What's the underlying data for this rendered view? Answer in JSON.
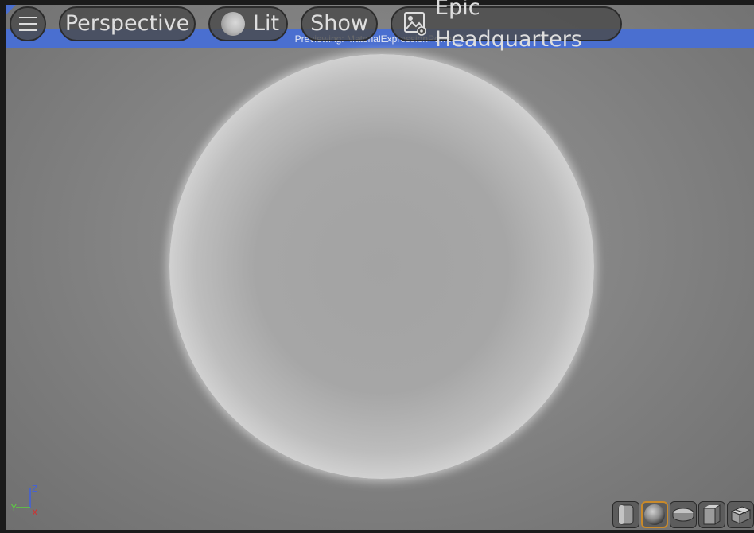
{
  "toolbar": {
    "menu_icon": "hamburger-menu-icon",
    "view_mode_label": "Perspective",
    "lighting_label": "Lit",
    "lighting_icon": "lit-sphere-icon",
    "show_label": "Show",
    "preview_scene_label": "Epic Headquarters",
    "preview_scene_icon": "scene-settings-icon"
  },
  "preview_banner": {
    "text": "Previewing: MaterialExpressionPower_3",
    "color": "#4a6fd0"
  },
  "axis_widget": {
    "x_label": "X",
    "y_label": "Y",
    "z_label": "Z",
    "x_color": "#d03030",
    "y_color": "#5cd040",
    "z_color": "#3f5fe0"
  },
  "preview_shapes": [
    {
      "name": "cylinder",
      "icon": "cylinder-icon",
      "active": false
    },
    {
      "name": "sphere",
      "icon": "sphere-icon",
      "active": true
    },
    {
      "name": "plane",
      "icon": "plane-icon",
      "active": false
    },
    {
      "name": "cube",
      "icon": "cube-icon",
      "active": false
    },
    {
      "name": "mesh",
      "icon": "teapot-mesh-icon",
      "active": false
    }
  ],
  "accent_color": "#c98a2a"
}
